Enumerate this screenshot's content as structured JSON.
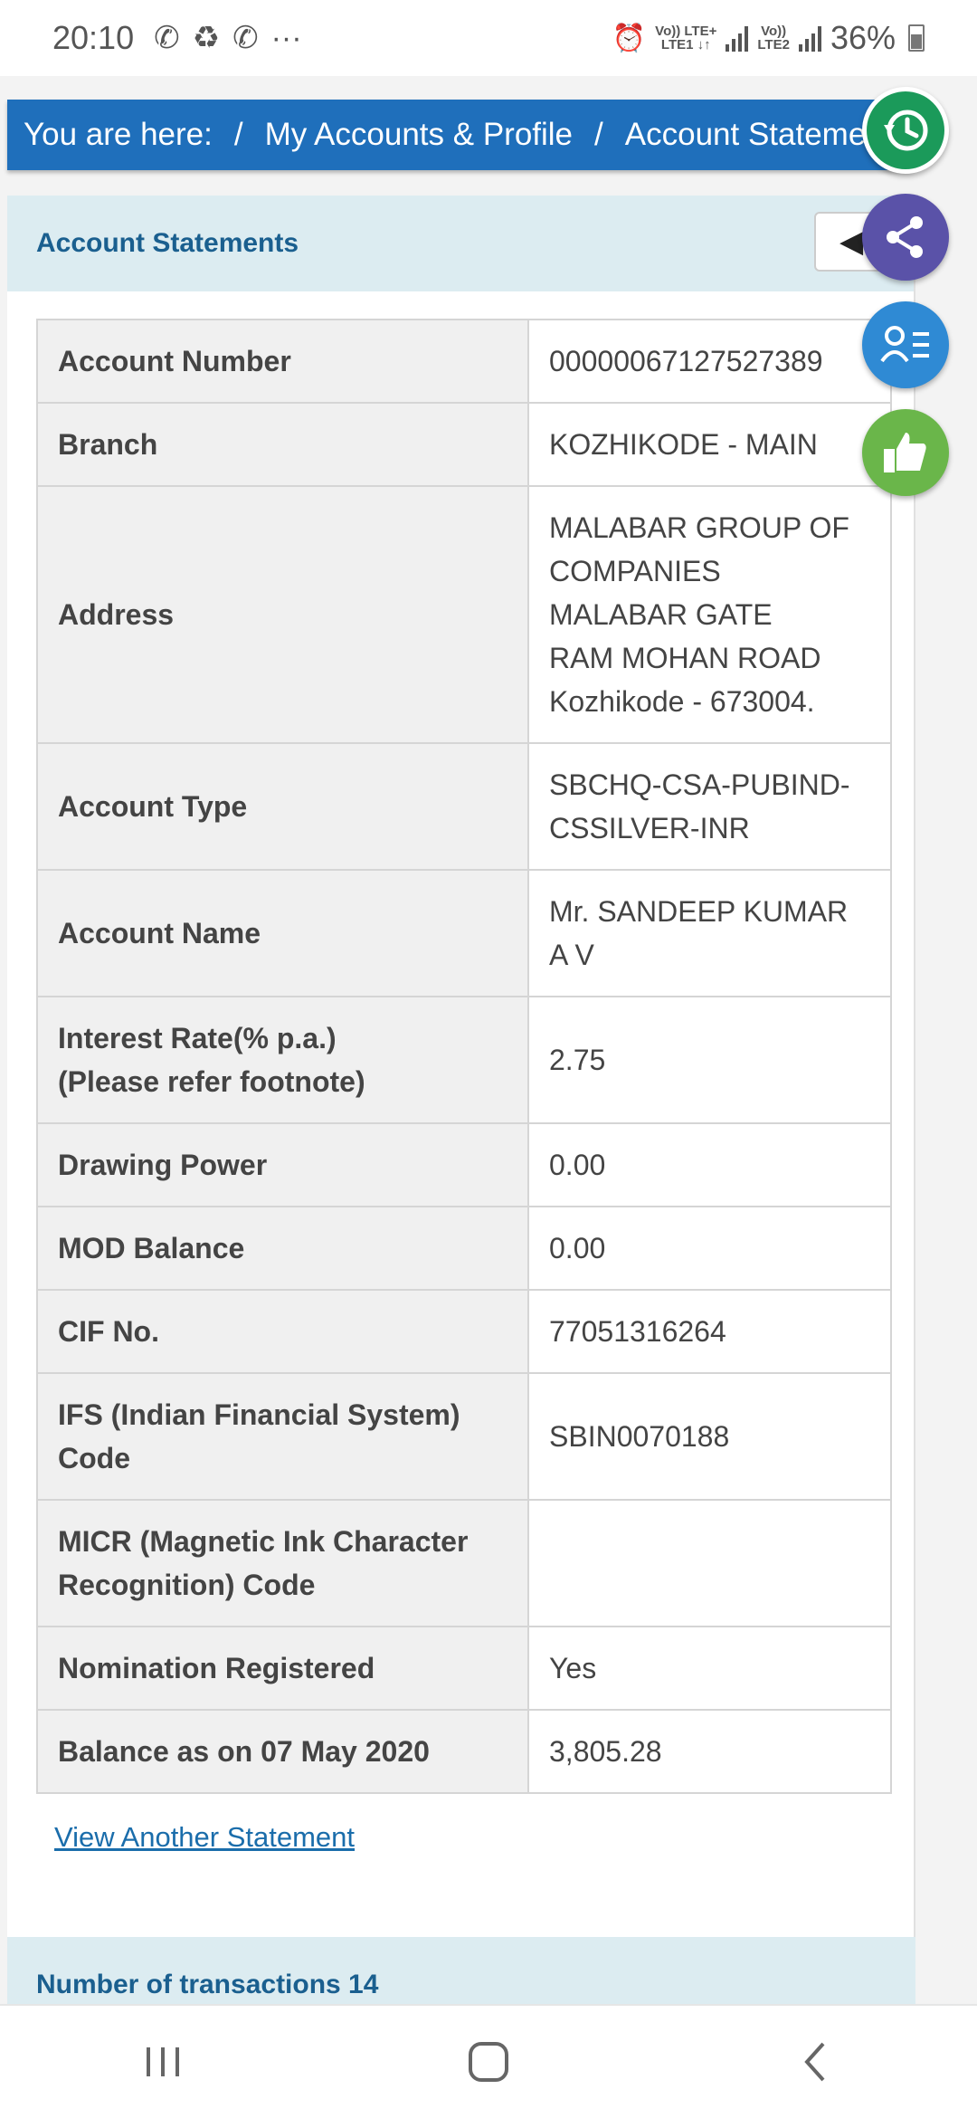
{
  "status_bar": {
    "time": "20:10",
    "battery": "36%",
    "sim1": [
      "Vo)) LTE+",
      "LTE1 ↓↑"
    ],
    "sim2": [
      "Vo))",
      "LTE2"
    ]
  },
  "breadcrumb": {
    "prefix": "You are here:",
    "items": [
      "My Accounts & Profile",
      "Account Stateme"
    ]
  },
  "panel": {
    "title": "Account Statements",
    "back_icon": "◀"
  },
  "account_details": [
    {
      "label": "Account Number",
      "value": [
        "00000067127527389"
      ]
    },
    {
      "label": "Branch",
      "value": [
        "KOZHIKODE - MAIN"
      ]
    },
    {
      "label": "Address",
      "value": [
        "MALABAR GROUP OF",
        "COMPANIES",
        "MALABAR GATE",
        "RAM MOHAN ROAD",
        "Kozhikode  - 673004."
      ]
    },
    {
      "label": "Account Type",
      "value": [
        "SBCHQ-CSA-PUBIND-",
        "CSSILVER-INR"
      ]
    },
    {
      "label": "Account Name",
      "value": [
        "Mr. SANDEEP KUMAR",
        "A V"
      ]
    },
    {
      "label": "Interest Rate(% p.a.)\n(Please refer footnote)",
      "value": [
        "2.75"
      ]
    },
    {
      "label": "Drawing Power",
      "value": [
        "0.00"
      ]
    },
    {
      "label": "MOD Balance",
      "value": [
        "0.00"
      ]
    },
    {
      "label": "CIF No.",
      "value": [
        "77051316264"
      ]
    },
    {
      "label": "IFS (Indian Financial System)\nCode",
      "value": [
        "SBIN0070188"
      ]
    },
    {
      "label": "MICR (Magnetic Ink Character\nRecognition) Code",
      "value": [
        ""
      ]
    },
    {
      "label": "Nomination Registered",
      "value": [
        "Yes"
      ]
    },
    {
      "label": "Balance as on 07 May 2020",
      "value": [
        "3,805.28"
      ]
    }
  ],
  "links": {
    "view_another": "View Another Statement"
  },
  "transactions": {
    "header": "Number of transactions 14"
  },
  "floating_buttons": [
    "history-icon",
    "share-icon",
    "profile-list-icon",
    "thumbs-up-icon"
  ],
  "colors": {
    "breadcrumb_bg": "#1f6fbb",
    "header_bg": "#dcecf1",
    "header_text": "#1a5f8f",
    "link": "#1a6dab"
  }
}
